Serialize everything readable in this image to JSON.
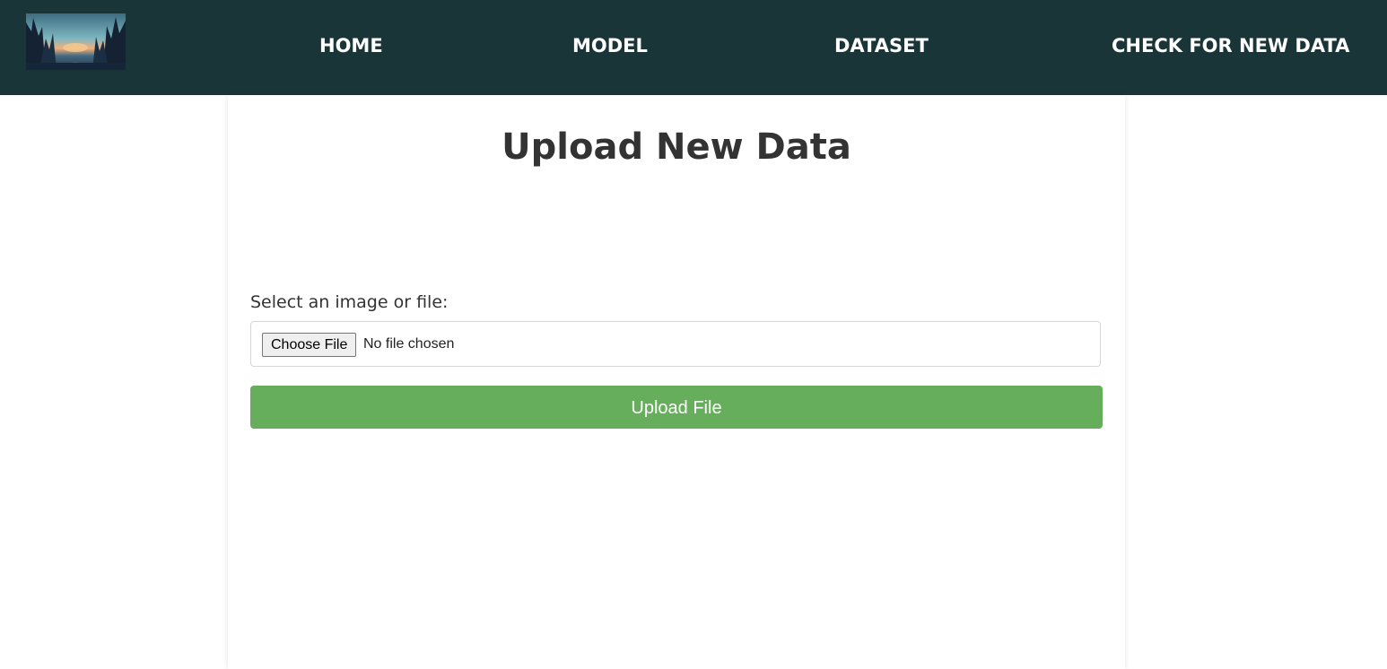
{
  "nav": {
    "logo_icon": "forest-sunset-image",
    "links": [
      {
        "label": "HOME"
      },
      {
        "label": "MODEL"
      },
      {
        "label": "DATASET"
      },
      {
        "label": "CHECK FOR NEW DATA"
      }
    ]
  },
  "main": {
    "title": "Upload New Data",
    "file_label": "Select an image or file:",
    "choose_file_label": "Choose File",
    "no_file_text": "No file chosen",
    "upload_button_label": "Upload File"
  },
  "colors": {
    "navbar_bg": "#1a3538",
    "upload_button": "#66ad5c",
    "title_text": "#333333"
  }
}
